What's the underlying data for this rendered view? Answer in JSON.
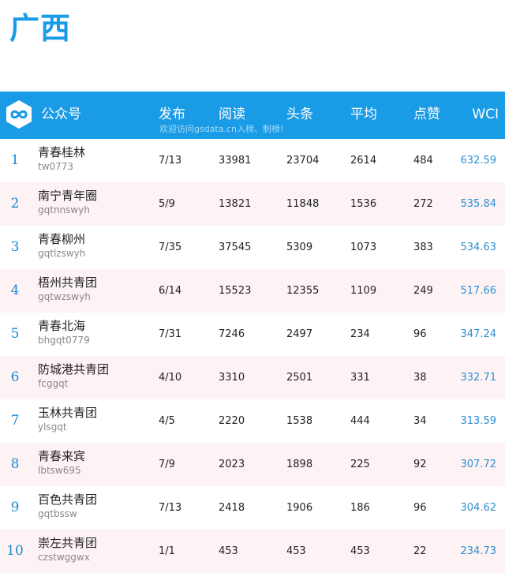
{
  "title": "广西",
  "colors": {
    "accent": "#1a9be6",
    "row_alt": "#fdf3f5",
    "wci": "#2d8fd1"
  },
  "header": {
    "logo_icon": "gsdata-infinity-logo-icon",
    "account": "公众号",
    "publish": "发布",
    "read": "阅读",
    "headline": "头条",
    "average": "平均",
    "like": "点赞",
    "wci": "WCI",
    "watermark": "欢迎访问gsdata.cn入榜、制榜!"
  },
  "rows": [
    {
      "rank": "1",
      "name": "青春桂林",
      "id": "tw0773",
      "publish": "7/13",
      "read": "33981",
      "headline": "23704",
      "average": "2614",
      "like": "484",
      "wci": "632.59"
    },
    {
      "rank": "2",
      "name": "南宁青年圈",
      "id": "gqtnnswyh",
      "publish": "5/9",
      "read": "13821",
      "headline": "11848",
      "average": "1536",
      "like": "272",
      "wci": "535.84"
    },
    {
      "rank": "3",
      "name": "青春柳州",
      "id": "gqtlzswyh",
      "publish": "7/35",
      "read": "37545",
      "headline": "5309",
      "average": "1073",
      "like": "383",
      "wci": "534.63"
    },
    {
      "rank": "4",
      "name": "梧州共青团",
      "id": "gqtwzswyh",
      "publish": "6/14",
      "read": "15523",
      "headline": "12355",
      "average": "1109",
      "like": "249",
      "wci": "517.66"
    },
    {
      "rank": "5",
      "name": "青春北海",
      "id": "bhgqt0779",
      "publish": "7/31",
      "read": "7246",
      "headline": "2497",
      "average": "234",
      "like": "96",
      "wci": "347.24"
    },
    {
      "rank": "6",
      "name": "防城港共青团",
      "id": "fcggqt",
      "publish": "4/10",
      "read": "3310",
      "headline": "2501",
      "average": "331",
      "like": "38",
      "wci": "332.71"
    },
    {
      "rank": "7",
      "name": "玉林共青团",
      "id": "ylsgqt",
      "publish": "4/5",
      "read": "2220",
      "headline": "1538",
      "average": "444",
      "like": "34",
      "wci": "313.59"
    },
    {
      "rank": "8",
      "name": "青春来宾",
      "id": "lbtsw695",
      "publish": "7/9",
      "read": "2023",
      "headline": "1898",
      "average": "225",
      "like": "92",
      "wci": "307.72"
    },
    {
      "rank": "9",
      "name": "百色共青团",
      "id": "gqtbssw",
      "publish": "7/13",
      "read": "2418",
      "headline": "1906",
      "average": "186",
      "like": "96",
      "wci": "304.62"
    },
    {
      "rank": "10",
      "name": "崇左共青团",
      "id": "czstwggwx",
      "publish": "1/1",
      "read": "453",
      "headline": "453",
      "average": "453",
      "like": "22",
      "wci": "234.73"
    }
  ]
}
